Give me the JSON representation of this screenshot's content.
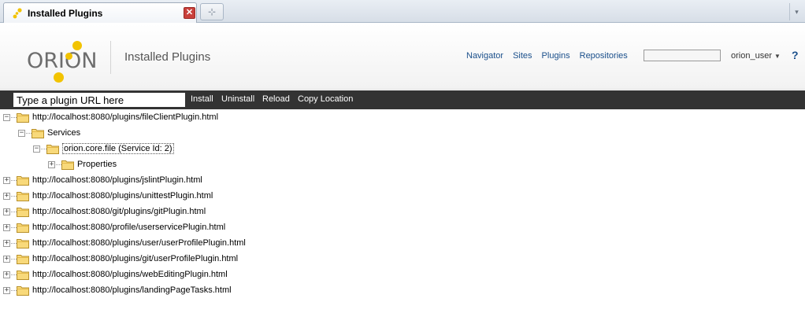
{
  "browser": {
    "tab_title": "Installed Plugins",
    "close_glyph": "✕",
    "newtab_glyph": "⊹",
    "tabs_menu_glyph": "▾"
  },
  "header": {
    "logo_text": "ORION",
    "page_title": "Installed Plugins",
    "nav": [
      "Navigator",
      "Sites",
      "Plugins",
      "Repositories"
    ],
    "search_value": "",
    "user": "orion_user",
    "help": "?"
  },
  "toolbar": {
    "url_placeholder": "Type a plugin URL here",
    "buttons": [
      "Install",
      "Uninstall",
      "Reload",
      "Copy Location"
    ]
  },
  "tree": [
    {
      "depth": 0,
      "expander": "−",
      "label": "http://localhost:8080/plugins/fileClientPlugin.html",
      "selected": false
    },
    {
      "depth": 1,
      "expander": "−",
      "label": "Services",
      "selected": false
    },
    {
      "depth": 2,
      "expander": "−",
      "label": "orion.core.file (Service Id: 2)",
      "selected": true
    },
    {
      "depth": 3,
      "expander": "+",
      "label": "Properties",
      "selected": false
    },
    {
      "depth": 0,
      "expander": "+",
      "label": "http://localhost:8080/plugins/jslintPlugin.html",
      "selected": false
    },
    {
      "depth": 0,
      "expander": "+",
      "label": "http://localhost:8080/plugins/unittestPlugin.html",
      "selected": false
    },
    {
      "depth": 0,
      "expander": "+",
      "label": "http://localhost:8080/git/plugins/gitPlugin.html",
      "selected": false
    },
    {
      "depth": 0,
      "expander": "+",
      "label": "http://localhost:8080/profile/userservicePlugin.html",
      "selected": false
    },
    {
      "depth": 0,
      "expander": "+",
      "label": "http://localhost:8080/plugins/user/userProfilePlugin.html",
      "selected": false
    },
    {
      "depth": 0,
      "expander": "+",
      "label": "http://localhost:8080/plugins/git/userProfilePlugin.html",
      "selected": false
    },
    {
      "depth": 0,
      "expander": "+",
      "label": "http://localhost:8080/plugins/webEditingPlugin.html",
      "selected": false
    },
    {
      "depth": 0,
      "expander": "+",
      "label": "http://localhost:8080/plugins/landingPageTasks.html",
      "selected": false
    }
  ],
  "colors": {
    "toolbar_bg": "#333333",
    "link": "#1a4f8b",
    "logo_yellow": "#f2c300",
    "folder_fill": "#f8d97a",
    "folder_stroke": "#b8902a"
  }
}
